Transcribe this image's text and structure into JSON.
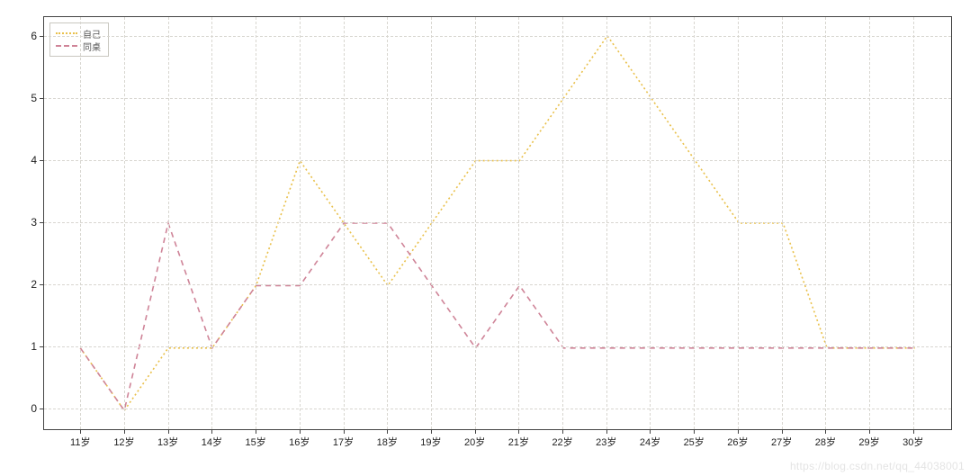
{
  "chart_data": {
    "type": "line",
    "title": "",
    "xlabel": "",
    "ylabel": "",
    "x_ticks": [
      "11岁",
      "12岁",
      "13岁",
      "14岁",
      "15岁",
      "16岁",
      "17岁",
      "18岁",
      "19岁",
      "20岁",
      "21岁",
      "22岁",
      "23岁",
      "24岁",
      "25岁",
      "26岁",
      "27岁",
      "28岁",
      "29岁",
      "30岁"
    ],
    "y_ticks": [
      0,
      1,
      2,
      3,
      4,
      5,
      6
    ],
    "ylim": [
      -0.3,
      6.3
    ],
    "categories": [
      "11岁",
      "12岁",
      "13岁",
      "14岁",
      "15岁",
      "16岁",
      "17岁",
      "18岁",
      "19岁",
      "20岁",
      "21岁",
      "22岁",
      "23岁",
      "24岁",
      "25岁",
      "26岁",
      "27岁",
      "28岁",
      "29岁",
      "30岁"
    ],
    "series": [
      {
        "name": "自己",
        "style": "dotted",
        "color": "#e9c04a",
        "values": [
          1,
          0,
          1,
          1,
          2,
          4,
          3,
          2,
          3,
          4,
          4,
          5,
          6,
          5,
          4,
          3,
          3,
          1,
          1,
          1
        ]
      },
      {
        "name": "同桌",
        "style": "dashed",
        "color": "#cf8498",
        "values": [
          1,
          0,
          3,
          1,
          2,
          2,
          3,
          3,
          2,
          1,
          2,
          1,
          1,
          1,
          1,
          1,
          1,
          1,
          1,
          1
        ]
      }
    ],
    "legend_position": "upper-left",
    "grid": true
  },
  "watermark": "https://blog.csdn.net/qq_44038001"
}
